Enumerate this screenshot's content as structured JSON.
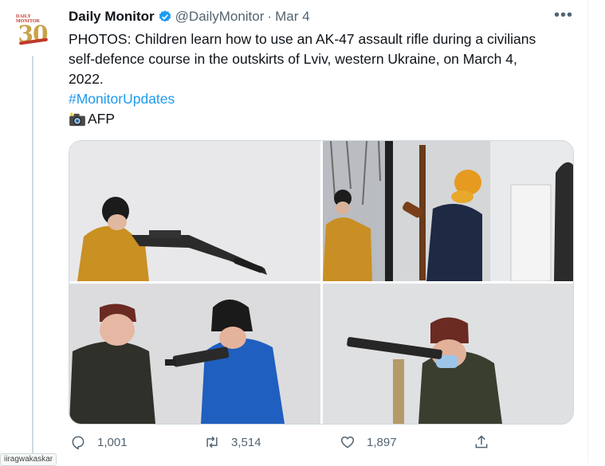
{
  "tweet": {
    "display_name": "Daily Monitor",
    "handle": "@DailyMonitor",
    "separator": "·",
    "date": "Mar 4",
    "more": "•••",
    "text_lines": [
      "PHOTOS: Children learn how to use an AK-47 assault rifle during a civilians",
      "self-defence course in the outskirts of Lviv, western Ukraine, on March 4,",
      "2022."
    ],
    "hashtag": "#MonitorUpdates",
    "credit": "AFP"
  },
  "avatar": {
    "logo_top": "DAILY MONITOR",
    "logo_number": "30"
  },
  "actions": {
    "reply_count": "1,001",
    "retweet_count": "3,514",
    "like_count": "1,897"
  },
  "tooltip": "iiragwakaskar",
  "colors": {
    "accent": "#1d9bf0",
    "muted": "#536471",
    "text": "#0f1419"
  }
}
